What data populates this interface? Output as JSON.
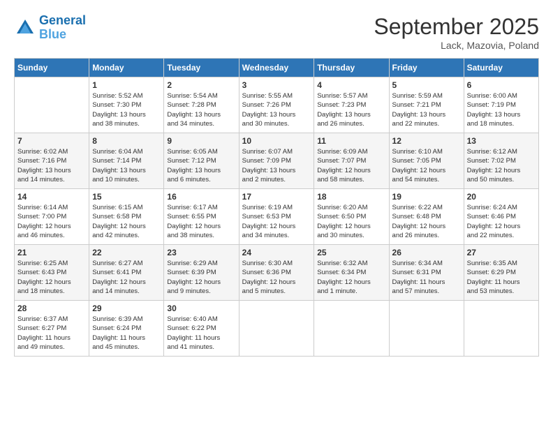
{
  "header": {
    "logo_line1": "General",
    "logo_line2": "Blue",
    "month": "September 2025",
    "location": "Lack, Mazovia, Poland"
  },
  "days_of_week": [
    "Sunday",
    "Monday",
    "Tuesday",
    "Wednesday",
    "Thursday",
    "Friday",
    "Saturday"
  ],
  "weeks": [
    [
      {
        "day": "",
        "info": ""
      },
      {
        "day": "1",
        "info": "Sunrise: 5:52 AM\nSunset: 7:30 PM\nDaylight: 13 hours\nand 38 minutes."
      },
      {
        "day": "2",
        "info": "Sunrise: 5:54 AM\nSunset: 7:28 PM\nDaylight: 13 hours\nand 34 minutes."
      },
      {
        "day": "3",
        "info": "Sunrise: 5:55 AM\nSunset: 7:26 PM\nDaylight: 13 hours\nand 30 minutes."
      },
      {
        "day": "4",
        "info": "Sunrise: 5:57 AM\nSunset: 7:23 PM\nDaylight: 13 hours\nand 26 minutes."
      },
      {
        "day": "5",
        "info": "Sunrise: 5:59 AM\nSunset: 7:21 PM\nDaylight: 13 hours\nand 22 minutes."
      },
      {
        "day": "6",
        "info": "Sunrise: 6:00 AM\nSunset: 7:19 PM\nDaylight: 13 hours\nand 18 minutes."
      }
    ],
    [
      {
        "day": "7",
        "info": "Sunrise: 6:02 AM\nSunset: 7:16 PM\nDaylight: 13 hours\nand 14 minutes."
      },
      {
        "day": "8",
        "info": "Sunrise: 6:04 AM\nSunset: 7:14 PM\nDaylight: 13 hours\nand 10 minutes."
      },
      {
        "day": "9",
        "info": "Sunrise: 6:05 AM\nSunset: 7:12 PM\nDaylight: 13 hours\nand 6 minutes."
      },
      {
        "day": "10",
        "info": "Sunrise: 6:07 AM\nSunset: 7:09 PM\nDaylight: 13 hours\nand 2 minutes."
      },
      {
        "day": "11",
        "info": "Sunrise: 6:09 AM\nSunset: 7:07 PM\nDaylight: 12 hours\nand 58 minutes."
      },
      {
        "day": "12",
        "info": "Sunrise: 6:10 AM\nSunset: 7:05 PM\nDaylight: 12 hours\nand 54 minutes."
      },
      {
        "day": "13",
        "info": "Sunrise: 6:12 AM\nSunset: 7:02 PM\nDaylight: 12 hours\nand 50 minutes."
      }
    ],
    [
      {
        "day": "14",
        "info": "Sunrise: 6:14 AM\nSunset: 7:00 PM\nDaylight: 12 hours\nand 46 minutes."
      },
      {
        "day": "15",
        "info": "Sunrise: 6:15 AM\nSunset: 6:58 PM\nDaylight: 12 hours\nand 42 minutes."
      },
      {
        "day": "16",
        "info": "Sunrise: 6:17 AM\nSunset: 6:55 PM\nDaylight: 12 hours\nand 38 minutes."
      },
      {
        "day": "17",
        "info": "Sunrise: 6:19 AM\nSunset: 6:53 PM\nDaylight: 12 hours\nand 34 minutes."
      },
      {
        "day": "18",
        "info": "Sunrise: 6:20 AM\nSunset: 6:50 PM\nDaylight: 12 hours\nand 30 minutes."
      },
      {
        "day": "19",
        "info": "Sunrise: 6:22 AM\nSunset: 6:48 PM\nDaylight: 12 hours\nand 26 minutes."
      },
      {
        "day": "20",
        "info": "Sunrise: 6:24 AM\nSunset: 6:46 PM\nDaylight: 12 hours\nand 22 minutes."
      }
    ],
    [
      {
        "day": "21",
        "info": "Sunrise: 6:25 AM\nSunset: 6:43 PM\nDaylight: 12 hours\nand 18 minutes."
      },
      {
        "day": "22",
        "info": "Sunrise: 6:27 AM\nSunset: 6:41 PM\nDaylight: 12 hours\nand 14 minutes."
      },
      {
        "day": "23",
        "info": "Sunrise: 6:29 AM\nSunset: 6:39 PM\nDaylight: 12 hours\nand 9 minutes."
      },
      {
        "day": "24",
        "info": "Sunrise: 6:30 AM\nSunset: 6:36 PM\nDaylight: 12 hours\nand 5 minutes."
      },
      {
        "day": "25",
        "info": "Sunrise: 6:32 AM\nSunset: 6:34 PM\nDaylight: 12 hours\nand 1 minute."
      },
      {
        "day": "26",
        "info": "Sunrise: 6:34 AM\nSunset: 6:31 PM\nDaylight: 11 hours\nand 57 minutes."
      },
      {
        "day": "27",
        "info": "Sunrise: 6:35 AM\nSunset: 6:29 PM\nDaylight: 11 hours\nand 53 minutes."
      }
    ],
    [
      {
        "day": "28",
        "info": "Sunrise: 6:37 AM\nSunset: 6:27 PM\nDaylight: 11 hours\nand 49 minutes."
      },
      {
        "day": "29",
        "info": "Sunrise: 6:39 AM\nSunset: 6:24 PM\nDaylight: 11 hours\nand 45 minutes."
      },
      {
        "day": "30",
        "info": "Sunrise: 6:40 AM\nSunset: 6:22 PM\nDaylight: 11 hours\nand 41 minutes."
      },
      {
        "day": "",
        "info": ""
      },
      {
        "day": "",
        "info": ""
      },
      {
        "day": "",
        "info": ""
      },
      {
        "day": "",
        "info": ""
      }
    ]
  ]
}
